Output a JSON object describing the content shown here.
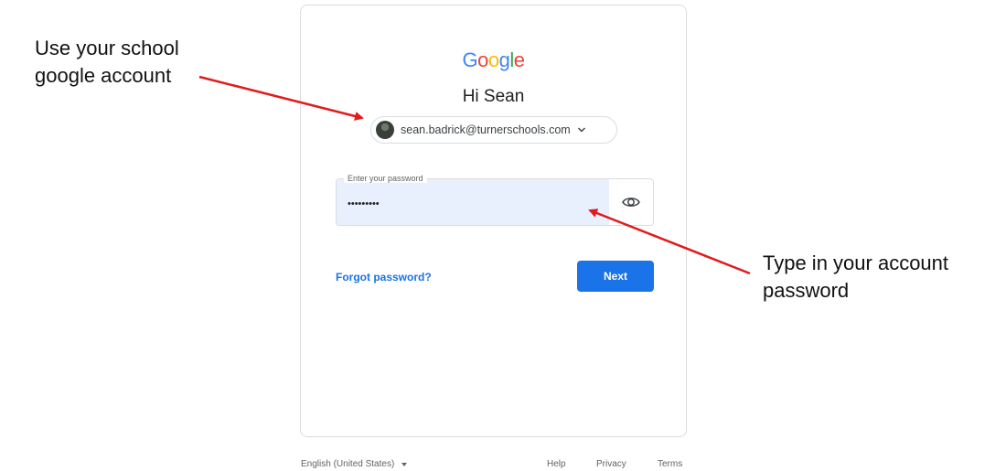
{
  "logo": {
    "letters": [
      "G",
      "o",
      "o",
      "g",
      "l",
      "e"
    ],
    "colors": [
      "#4285F4",
      "#EA4335",
      "#FBBC05",
      "#4285F4",
      "#34A853",
      "#EA4335"
    ]
  },
  "greeting": "Hi Sean",
  "account": {
    "email": "sean.badrick@turnerschools.com"
  },
  "password_field": {
    "label": "Enter your password",
    "value": "•••••••••"
  },
  "actions": {
    "forgot": "Forgot password?",
    "next": "Next"
  },
  "footer": {
    "language": "English (United States)",
    "help": "Help",
    "privacy": "Privacy",
    "terms": "Terms"
  },
  "annotations": {
    "left_line1": "Use your school",
    "left_line2": "google account",
    "right_line1": "Type in your account",
    "right_line2": "password"
  },
  "colors": {
    "accent": "#1a73e8",
    "arrow": "#e01b1b",
    "field_fill": "#e8f0fe"
  },
  "icons": {
    "chevron": "chevron-down-icon",
    "eye": "eye-icon",
    "avatar": "avatar"
  }
}
